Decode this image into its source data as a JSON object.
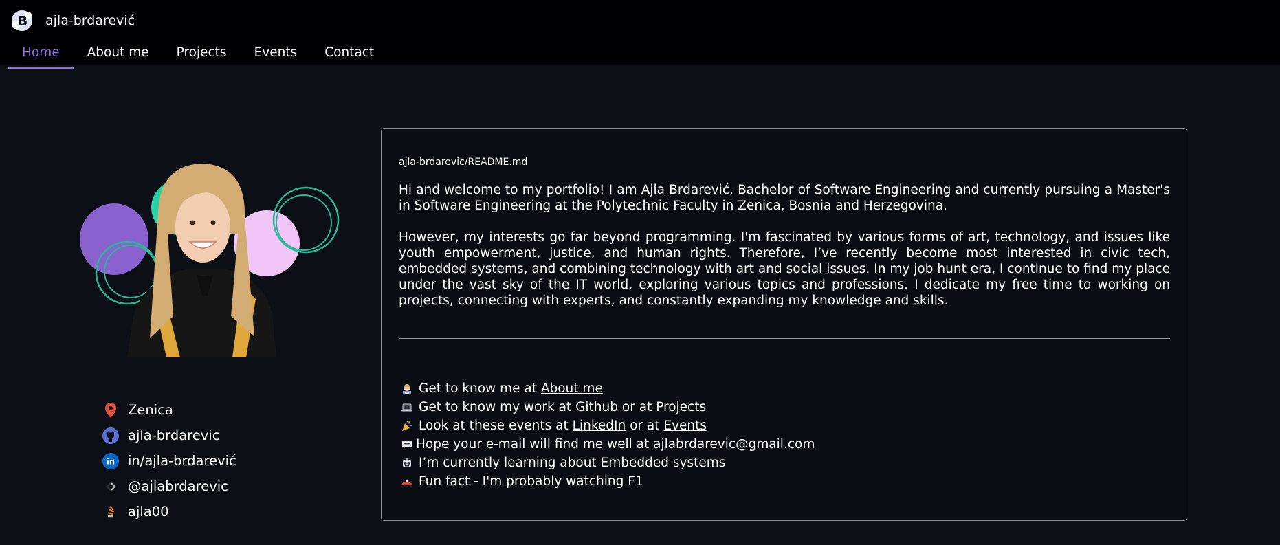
{
  "brand": {
    "name": "ajla-brdarević"
  },
  "nav": {
    "home": "Home",
    "about": "About me",
    "projects": "Projects",
    "events": "Events",
    "contact": "Contact"
  },
  "contacts": {
    "location": "Zenica",
    "github": "ajla-brdarevic",
    "linkedin": "in/ajla-brdarević",
    "twitter": "@ajlabrdarevic",
    "stackoverflow": "ajla00"
  },
  "readme": {
    "filename": "ajla-brdarevic/README.md",
    "paragraph1": "Hi and welcome to my portfolio! I am Ajla Brdarević, Bachelor of Software Engineering and currently pursuing a Master's in Software Engineering at the Polytechnic Faculty in Zenica, Bosnia and Herzegovina.",
    "paragraph2": "However, my interests go far beyond programming. I'm fascinated by various forms of art, technology, and issues like youth empowerment, justice, and human rights. Therefore, I’ve recently become most interested in civic tech, embedded systems, and combining technology with art and social issues. In my job hunt era, I continue to find my place under the vast sky of the IT world, exploring various topics and professions. I dedicate my free time to working on projects, connecting with experts, and constantly expanding my knowledge and skills.",
    "items": {
      "about": {
        "text": "Get to know me at",
        "link": "About me"
      },
      "work": {
        "text": "Get to know my work at",
        "link1": "Github",
        "or": "or at",
        "link2": "Projects"
      },
      "events": {
        "text": "Look at these events at",
        "link1": "LinkedIn",
        "or": "or at",
        "link2": "Events"
      },
      "email": {
        "text": "Hope your e-mail will find me well at",
        "link": "ajlabrdarevic@gmail.com"
      },
      "learning": {
        "text": "I’m currently learning about Embedded systems"
      },
      "funfact": {
        "text": "Fun fact - I'm probably watching F1"
      }
    }
  },
  "colors": {
    "accent": "#8f6fe0",
    "background": "#0d0f17",
    "topbar": "#010104"
  }
}
